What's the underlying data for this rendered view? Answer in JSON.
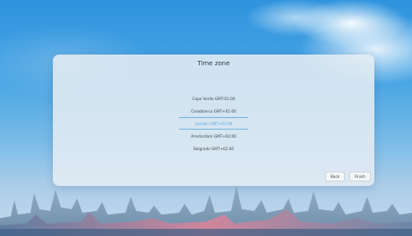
{
  "dialog": {
    "title": "Time zone",
    "timezones": [
      "Cape Verde GMT-01:00",
      "Casablanca GMT+01:00",
      "London GMT+01:00",
      "Amsterdam GMT+02:00",
      "Belgrade GMT+02:00"
    ],
    "selected_index": 2,
    "back_label": "Back",
    "finish_label": "Finish"
  },
  "colors": {
    "accent": "#5aa4dc",
    "sky_top": "#2f93de"
  }
}
